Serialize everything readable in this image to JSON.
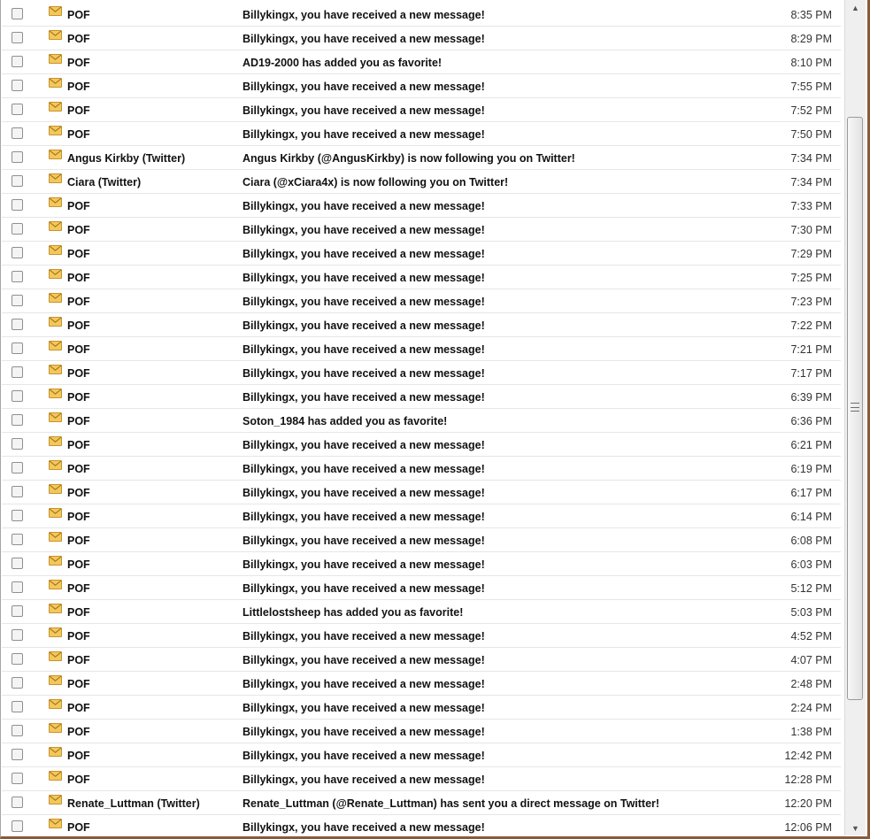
{
  "colors": {
    "envelope_fill": "#f3c85a",
    "envelope_stroke": "#c7922e",
    "frame_accent": "#8a5a3a"
  },
  "icons": {
    "row_icon": "envelope-icon",
    "scroll_up": "arrow-up-icon",
    "scroll_down": "arrow-down-icon"
  },
  "scrollbar": {
    "up": "▲",
    "down": "▼"
  },
  "messages": [
    {
      "from": "POF",
      "subject": "Billykingx, you have received a new message!",
      "time": "8:35 PM"
    },
    {
      "from": "POF",
      "subject": "Billykingx, you have received a new message!",
      "time": "8:29 PM"
    },
    {
      "from": "POF",
      "subject": "AD19-2000 has added you as favorite!",
      "time": "8:10 PM"
    },
    {
      "from": "POF",
      "subject": "Billykingx, you have received a new message!",
      "time": "7:55 PM"
    },
    {
      "from": "POF",
      "subject": "Billykingx, you have received a new message!",
      "time": "7:52 PM"
    },
    {
      "from": "POF",
      "subject": "Billykingx, you have received a new message!",
      "time": "7:50 PM"
    },
    {
      "from": "Angus Kirkby (Twitter)",
      "subject": "Angus Kirkby (@AngusKirkby) is now following you on Twitter!",
      "time": "7:34 PM"
    },
    {
      "from": "Ciara (Twitter)",
      "subject": "Ciara (@xCiara4x) is now following you on Twitter!",
      "time": "7:34 PM"
    },
    {
      "from": "POF",
      "subject": "Billykingx, you have received a new message!",
      "time": "7:33 PM"
    },
    {
      "from": "POF",
      "subject": "Billykingx, you have received a new message!",
      "time": "7:30 PM"
    },
    {
      "from": "POF",
      "subject": "Billykingx, you have received a new message!",
      "time": "7:29 PM"
    },
    {
      "from": "POF",
      "subject": "Billykingx, you have received a new message!",
      "time": "7:25 PM"
    },
    {
      "from": "POF",
      "subject": "Billykingx, you have received a new message!",
      "time": "7:23 PM"
    },
    {
      "from": "POF",
      "subject": "Billykingx, you have received a new message!",
      "time": "7:22 PM"
    },
    {
      "from": "POF",
      "subject": "Billykingx, you have received a new message!",
      "time": "7:21 PM"
    },
    {
      "from": "POF",
      "subject": "Billykingx, you have received a new message!",
      "time": "7:17 PM"
    },
    {
      "from": "POF",
      "subject": "Billykingx, you have received a new message!",
      "time": "6:39 PM"
    },
    {
      "from": "POF",
      "subject": "Soton_1984 has added you as favorite!",
      "time": "6:36 PM"
    },
    {
      "from": "POF",
      "subject": "Billykingx, you have received a new message!",
      "time": "6:21 PM"
    },
    {
      "from": "POF",
      "subject": "Billykingx, you have received a new message!",
      "time": "6:19 PM"
    },
    {
      "from": "POF",
      "subject": "Billykingx, you have received a new message!",
      "time": "6:17 PM"
    },
    {
      "from": "POF",
      "subject": "Billykingx, you have received a new message!",
      "time": "6:14 PM"
    },
    {
      "from": "POF",
      "subject": "Billykingx, you have received a new message!",
      "time": "6:08 PM"
    },
    {
      "from": "POF",
      "subject": "Billykingx, you have received a new message!",
      "time": "6:03 PM"
    },
    {
      "from": "POF",
      "subject": "Billykingx, you have received a new message!",
      "time": "5:12 PM"
    },
    {
      "from": "POF",
      "subject": "Littlelostsheep has added you as favorite!",
      "time": "5:03 PM"
    },
    {
      "from": "POF",
      "subject": "Billykingx, you have received a new message!",
      "time": "4:52 PM"
    },
    {
      "from": "POF",
      "subject": "Billykingx, you have received a new message!",
      "time": "4:07 PM"
    },
    {
      "from": "POF",
      "subject": "Billykingx, you have received a new message!",
      "time": "2:48 PM"
    },
    {
      "from": "POF",
      "subject": "Billykingx, you have received a new message!",
      "time": "2:24 PM"
    },
    {
      "from": "POF",
      "subject": "Billykingx, you have received a new message!",
      "time": "1:38 PM"
    },
    {
      "from": "POF",
      "subject": "Billykingx, you have received a new message!",
      "time": "12:42 PM"
    },
    {
      "from": "POF",
      "subject": "Billykingx, you have received a new message!",
      "time": "12:28 PM"
    },
    {
      "from": "Renate_Luttman (Twitter)",
      "subject": "Renate_Luttman (@Renate_Luttman) has sent you a direct message on Twitter!",
      "time": "12:20 PM"
    },
    {
      "from": "POF",
      "subject": "Billykingx, you have received a new message!",
      "time": "12:06 PM"
    }
  ]
}
